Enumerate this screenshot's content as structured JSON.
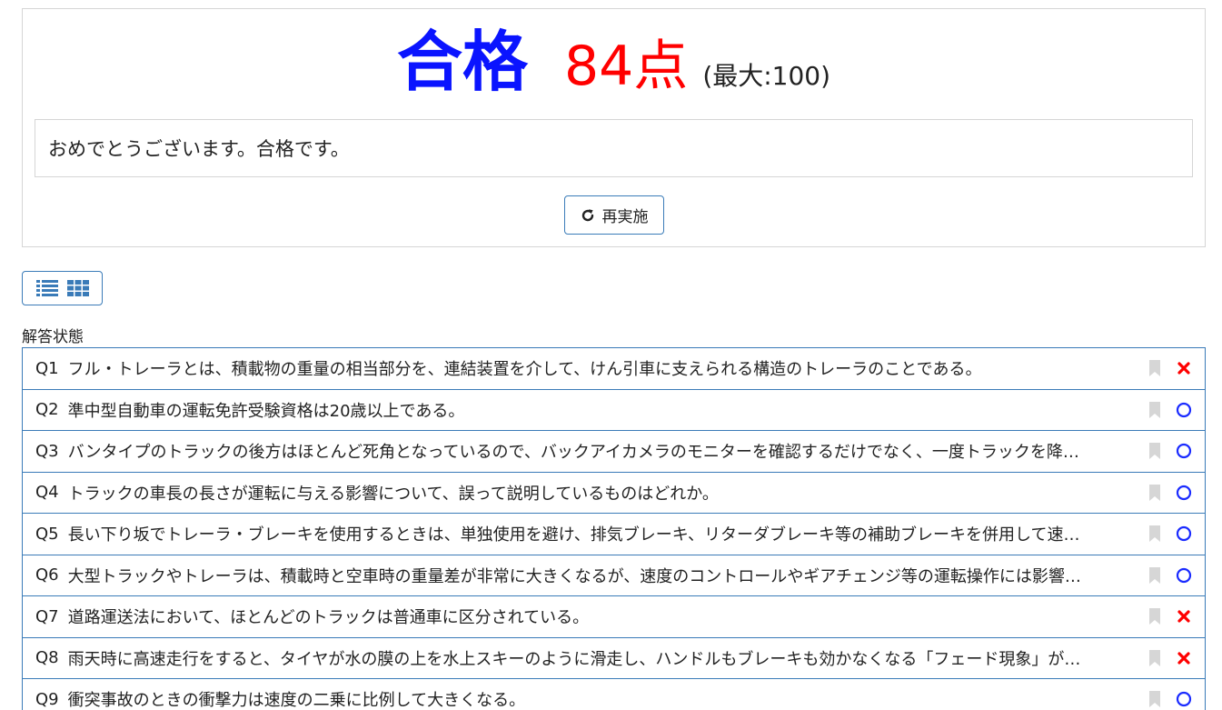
{
  "result": {
    "pass_label": "合格",
    "score": "84点",
    "max": "(最大:100)",
    "message": "おめでとうございます。合格です。",
    "retry_label": "再実施"
  },
  "status_heading": "解答状態",
  "colors": {
    "pass": "#0a14ff",
    "score": "#ff0000",
    "correct": "#1a2bff",
    "incorrect": "#ff0000",
    "border": "#3a7bb8",
    "bookmark": "#d6d6d6"
  },
  "questions": [
    {
      "num": "Q1",
      "text": "フル・トレーラとは、積載物の重量の相当部分を、連結装置を介して、けん引車に支えられる構造のトレーラのことである。",
      "result": "incorrect"
    },
    {
      "num": "Q2",
      "text": "準中型自動車の運転免許受験資格は20歳以上である。",
      "result": "correct"
    },
    {
      "num": "Q3",
      "text": "バンタイプのトラックの後方はほとんど死角となっているので、バックアイカメラのモニターを確認するだけでなく、一度トラックを降…",
      "result": "correct"
    },
    {
      "num": "Q4",
      "text": "トラックの車長の長さが運転に与える影響について、誤って説明しているものはどれか。",
      "result": "correct"
    },
    {
      "num": "Q5",
      "text": "長い下り坂でトレーラ・ブレーキを使用するときは、単独使用を避け、排気ブレーキ、リターダブレーキ等の補助ブレーキを併用して速…",
      "result": "correct"
    },
    {
      "num": "Q6",
      "text": "大型トラックやトレーラは、積載時と空車時の重量差が非常に大きくなるが、速度のコントロールやギアチェンジ等の運転操作には影響…",
      "result": "correct"
    },
    {
      "num": "Q7",
      "text": "道路運送法において、ほとんどのトラックは普通車に区分されている。",
      "result": "incorrect"
    },
    {
      "num": "Q8",
      "text": "雨天時に高速走行をすると、タイヤが水の膜の上を水上スキーのように滑走し、ハンドルもブレーキも効かなくなる「フェード現象」が…",
      "result": "incorrect"
    },
    {
      "num": "Q9",
      "text": "衝突事故のときの衝撃力は速度の二乗に比例して大きくなる。",
      "result": "correct"
    }
  ]
}
